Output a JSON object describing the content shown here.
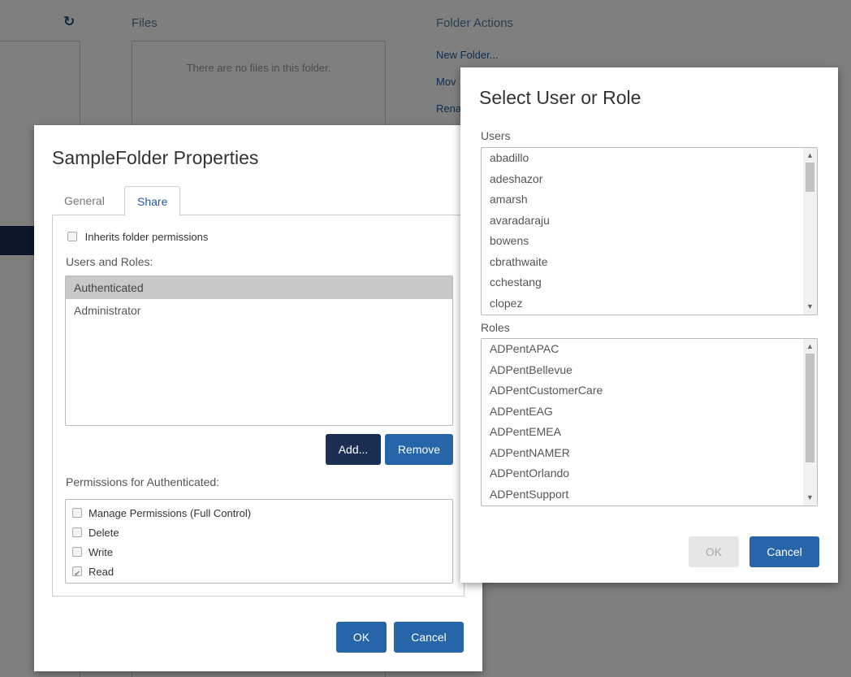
{
  "background": {
    "files_title": "Files",
    "no_files_text": "There are no files in this folder.",
    "actions_title": "Folder Actions",
    "actions": [
      "New Folder...",
      "Mov",
      "Rena"
    ]
  },
  "properties_dialog": {
    "title": "SampleFolder Properties",
    "tabs": [
      "General",
      "Share"
    ],
    "inherit_label": "Inherits folder permissions",
    "users_roles_label": "Users and Roles:",
    "users_roles": [
      "Authenticated",
      "Administrator"
    ],
    "selected_user_role": "Authenticated",
    "add_label": "Add...",
    "remove_label": "Remove",
    "permissions_label": "Permissions for Authenticated:",
    "permissions": [
      {
        "label": "Manage Permissions (Full Control)",
        "checked": false
      },
      {
        "label": "Delete",
        "checked": false
      },
      {
        "label": "Write",
        "checked": false
      },
      {
        "label": "Read",
        "checked": true
      }
    ],
    "ok_label": "OK",
    "cancel_label": "Cancel"
  },
  "select_dialog": {
    "title": "Select User or Role",
    "users_label": "Users",
    "users": [
      "abadillo",
      "adeshazor",
      "amarsh",
      "avaradaraju",
      "bowens",
      "cbrathwaite",
      "cchestang",
      "clopez"
    ],
    "roles_label": "Roles",
    "roles": [
      "ADPentAPAC",
      "ADPentBellevue",
      "ADPentCustomerCare",
      "ADPentEAG",
      "ADPentEMEA",
      "ADPentNAMER",
      "ADPentOrlando",
      "ADPentSupport"
    ],
    "ok_label": "OK",
    "cancel_label": "Cancel"
  },
  "colors": {
    "primary_button": "#2565a8",
    "dark_button": "#1b2f55",
    "selected_row": "#c8c8c8"
  }
}
